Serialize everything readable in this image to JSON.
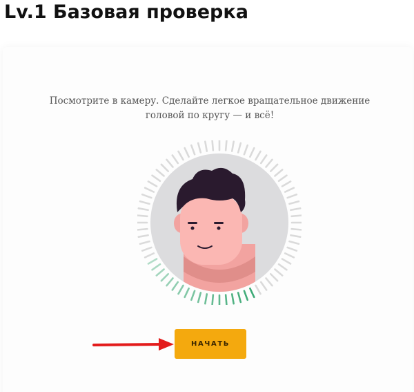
{
  "header": {
    "title": "Lv.1 Базовая проверка"
  },
  "verification": {
    "instruction": "Посмотрите в камеру. Сделайте легкое вращательное движение головой по кругу — и всё!",
    "progress": 0.25,
    "start_label": "НАЧАТЬ"
  },
  "colors": {
    "accent": "#f4a90e",
    "progress_active": "#3daa76",
    "progress_inactive": "#dadada",
    "annotation_arrow": "#e31b1b"
  },
  "icons": {
    "avatar": "face-avatar-icon",
    "arrow": "red-arrow-icon"
  }
}
